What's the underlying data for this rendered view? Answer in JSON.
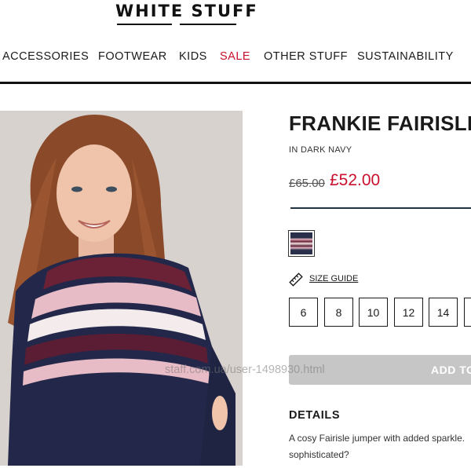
{
  "brand": {
    "logo_text": "WHITE STUFF"
  },
  "nav": {
    "items": [
      {
        "label": "ACCESSORIES"
      },
      {
        "label": "FOOTWEAR"
      },
      {
        "label": "KIDS"
      },
      {
        "label": "SALE",
        "color": "#c8102e"
      },
      {
        "label": "OTHER STUFF"
      },
      {
        "label": "SUSTAINABILITY"
      }
    ]
  },
  "product": {
    "title": "FRANKIE FAIRISLE",
    "colour": "IN DARK NAVY",
    "price_was": "£65.00",
    "price_now": "£52.00",
    "price_color": "#c8102e",
    "swatch_icon": "fairisle-pattern-swatch",
    "size_guide_label": "SIZE GUIDE",
    "sizes": [
      "6",
      "8",
      "10",
      "12",
      "14"
    ],
    "add_button_label": "ADD TO",
    "details_heading": "DETAILS",
    "details_lines": [
      "A cosy Fairisle jumper with added sparkle.",
      "sophisticated?"
    ]
  },
  "watermark": {
    "text": "staff.com.ua/user-1498930.html"
  }
}
